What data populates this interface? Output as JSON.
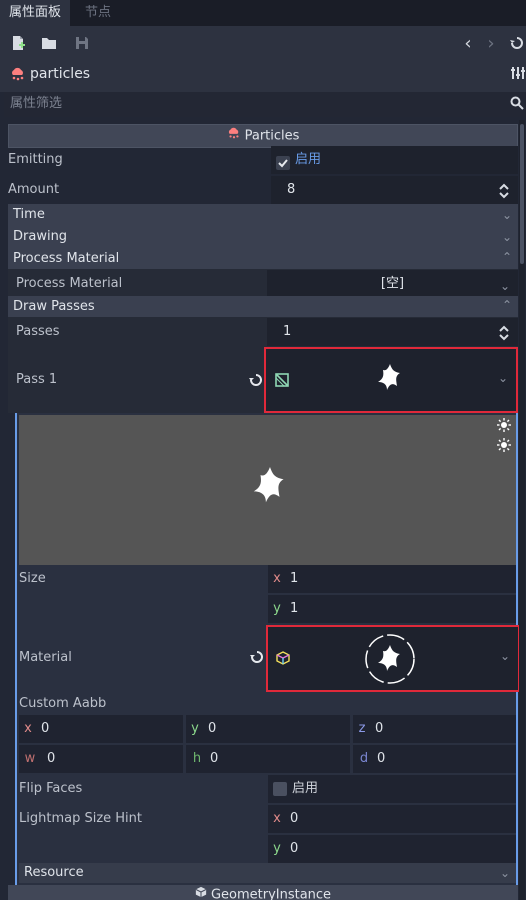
{
  "tabs": [
    {
      "label": "属性面板"
    },
    {
      "label": "节点"
    }
  ],
  "object_name": "particles",
  "filter_placeholder": "属性筛选",
  "particles_header": "Particles",
  "properties": {
    "emitting": {
      "label": "Emitting",
      "check_label": "启用",
      "checked": true
    },
    "amount": {
      "label": "Amount",
      "value": "8"
    }
  },
  "sections": {
    "time": "Time",
    "drawing": "Drawing",
    "process_material": "Process Material",
    "draw_passes": "Draw Passes",
    "resource": "Resource"
  },
  "process_material": {
    "label": "Process Material",
    "value": "[空]"
  },
  "passes": {
    "label": "Passes",
    "value": "1"
  },
  "pass1": {
    "label": "Pass 1"
  },
  "mesh": {
    "size_label": "Size",
    "size_x": "1",
    "size_y": "1",
    "material_label": "Material",
    "custom_aabb_label": "Custom Aabb",
    "aabb": {
      "x": "0",
      "y": "0",
      "z": "0",
      "w": "0",
      "h": "0",
      "d": "0"
    },
    "flip_faces_label": "Flip Faces",
    "flip_faces_check_label": "启用",
    "lightmap_label": "Lightmap Size Hint",
    "lightmap_x": "0",
    "lightmap_y": "0"
  },
  "axis_letters": {
    "x": "x",
    "y": "y",
    "z": "z",
    "w": "w",
    "h": "h",
    "d": "d"
  },
  "geometry_header": "GeometryInstance",
  "colors": {
    "accent_blue": "#699ce8",
    "highlight_red": "#e0293a",
    "bg": "#222735",
    "field_bg": "#1e222d"
  }
}
